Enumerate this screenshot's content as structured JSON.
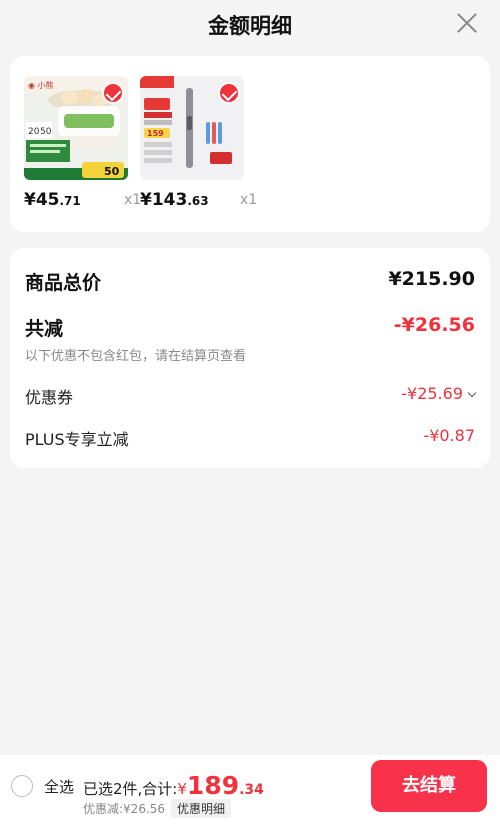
{
  "header": {
    "title": "金额明细"
  },
  "goods": [
    {
      "price_yen": "¥45",
      "price_dec": ".71",
      "qty": "x1",
      "thumb": "egg-steamer"
    },
    {
      "price_yen": "¥143",
      "price_dec": ".63",
      "qty": "x1",
      "thumb": "electric-toothbrush"
    }
  ],
  "summary": {
    "total_label": "商品总价",
    "total_value": "¥215.90",
    "reduce_label": "共减",
    "reduce_value": "-¥26.56",
    "reduce_note": "以下优惠不包含红包，请在结算页查看",
    "coupon_label": "优惠券",
    "coupon_value": "-¥25.69",
    "plus_label": "PLUS专享立减",
    "plus_value": "-¥0.87"
  },
  "bottom": {
    "select_all": "全选",
    "selected_text": "已选2件,合计:",
    "currency": "¥",
    "total_int": "189",
    "total_dec": ".34",
    "discount_text": "优惠减:¥26.56",
    "discount_button": "优惠明细",
    "checkout_label": "去结算"
  },
  "colors": {
    "accent": "#f0323c",
    "checkout": "#f7324a"
  }
}
